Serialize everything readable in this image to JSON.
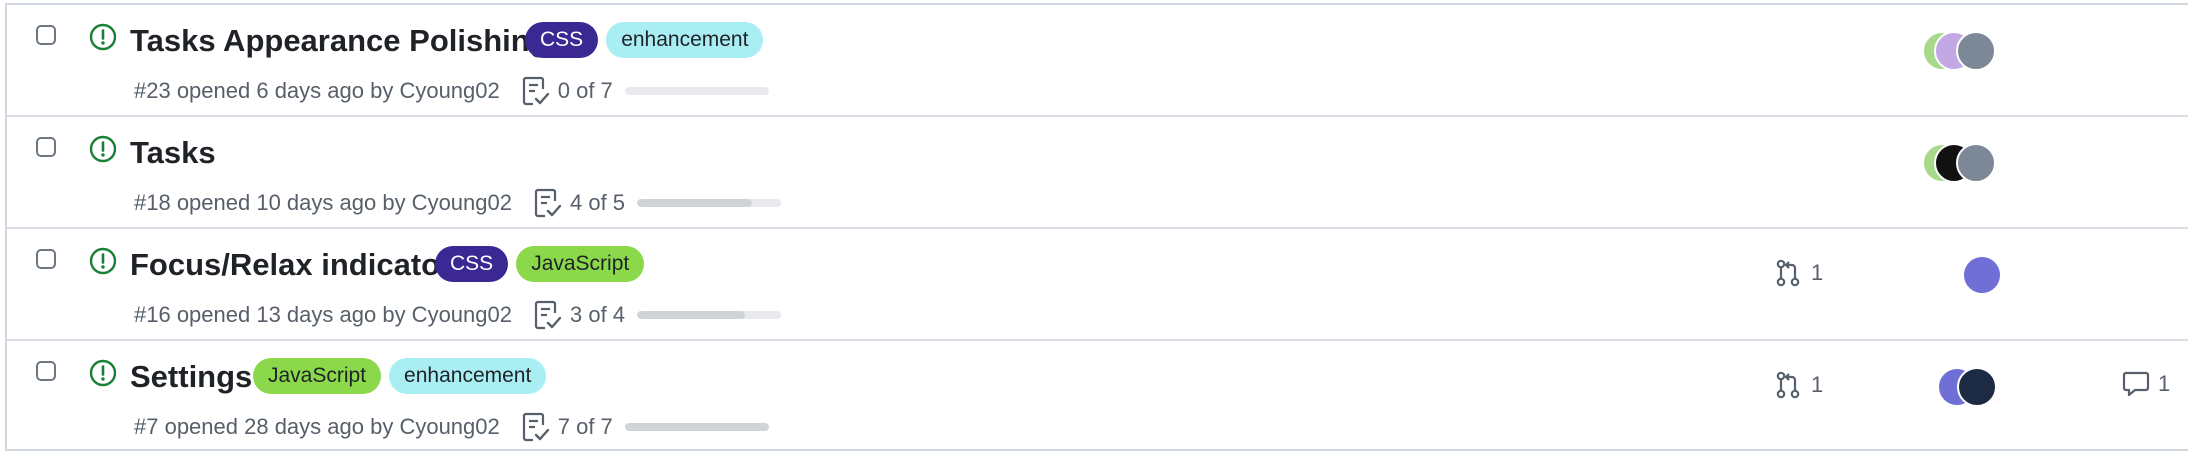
{
  "issues": [
    {
      "title": "Tasks Appearance Polishing",
      "labels": [
        {
          "text": "CSS",
          "kind": "css"
        },
        {
          "text": "enhancement",
          "kind": "enh"
        }
      ],
      "number_line": "#23 opened 6 days ago by Cyoung02",
      "tasks": "0 of 7",
      "progress": 0,
      "pr_count": "",
      "comment_count": ""
    },
    {
      "title": "Tasks",
      "labels": [],
      "number_line": "#18 opened 10 days ago by Cyoung02",
      "tasks": "4 of 5",
      "progress": 0.8,
      "pr_count": "",
      "comment_count": ""
    },
    {
      "title": "Focus/Relax indicator",
      "labels": [
        {
          "text": "CSS",
          "kind": "css"
        },
        {
          "text": "JavaScript",
          "kind": "js"
        }
      ],
      "number_line": "#16 opened 13 days ago by Cyoung02",
      "tasks": "3 of 4",
      "progress": 0.75,
      "pr_count": "1",
      "comment_count": ""
    },
    {
      "title": "Settings",
      "labels": [
        {
          "text": "JavaScript",
          "kind": "js"
        },
        {
          "text": "enhancement",
          "kind": "enh"
        }
      ],
      "number_line": "#7 opened 28 days ago by Cyoung02",
      "tasks": "7 of 7",
      "progress": 1,
      "pr_count": "1",
      "comment_count": "1"
    }
  ],
  "colors": {
    "open_icon": "#1a7f37",
    "css_label": "#3b2893",
    "enhancement_label": "#a9eef2",
    "javascript_label": "#8bd94a"
  },
  "icons": [
    "issue-opened-icon",
    "tasklist-icon",
    "git-pull-request-icon",
    "comment-icon"
  ]
}
